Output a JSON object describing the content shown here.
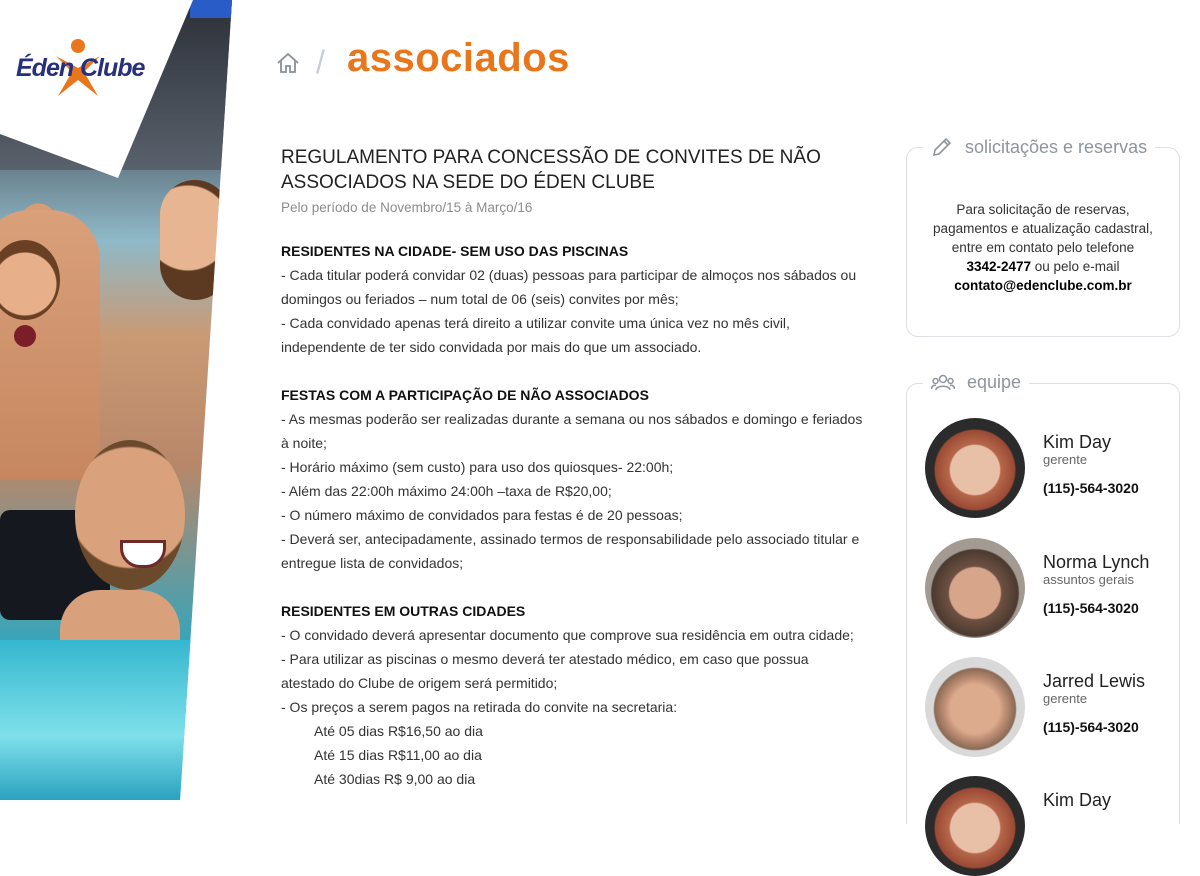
{
  "brand": {
    "name_part1": "Éden",
    "name_part2": "Clube",
    "accent_color": "#e8761b",
    "logo_color": "#27307d"
  },
  "header": {
    "home_icon": "home-icon",
    "separator": "/",
    "title": "associados"
  },
  "document": {
    "title": "REGULAMENTO PARA CONCESSÃO DE CONVITES DE NÃO ASSOCIADOS NA SEDE DO ÉDEN CLUBE",
    "title_line1": "REGULAMENTO PARA CONCESSÃO DE CONVITES DE NÃO",
    "title_line2": "ASSOCIADOS NA SEDE DO ÉDEN CLUBE",
    "period": "Pelo período de Novembro/15 à Março/16",
    "sections": [
      {
        "title": "RESIDENTES NA CIDADE- SEM USO DAS PISCINAS",
        "lines": [
          "- Cada titular poderá convidar 02 (duas) pessoas para participar de almoços nos sábados ou",
          "domingos ou feriados – num total de 06 (seis) convites por mês;",
          "- Cada convidado apenas terá direito a utilizar convite uma única vez no mês civil,",
          "independente de ter sido convidada por mais do que um associado."
        ]
      },
      {
        "title": "FESTAS COM A PARTICIPAÇÃO DE NÃO ASSOCIADOS",
        "lines": [
          "- As mesmas poderão ser realizadas durante a semana ou nos sábados e domingo e feriados",
          "à noite;",
          "- Horário máximo (sem custo) para uso dos quiosques- 22:00h;",
          "- Além das 22:00h máximo 24:00h –taxa de R$20,00;",
          "- O número máximo de convidados para festas é de 20 pessoas;",
          "- Deverá ser, antecipadamente, assinado termos de responsabilidade pelo associado titular e",
          "entregue lista de convidados;"
        ]
      },
      {
        "title": "RESIDENTES EM OUTRAS CIDADES",
        "lines": [
          "- O convidado deverá apresentar documento que comprove sua residência em outra cidade;",
          "- Para utilizar as piscinas o mesmo deverá ter atestado médico, em caso que possua",
          "atestado do Clube de origem será permitido;",
          "- Os preços a serem pagos na retirada do convite na secretaria:"
        ],
        "prices": [
          "Até 05 dias R$16,50 ao dia",
          "Até 15 dias R$11,00 ao dia",
          "Até 30dias R$ 9,00 ao dia"
        ]
      }
    ]
  },
  "sidebar": {
    "requests": {
      "icon": "pencil-icon",
      "title": "solicitações e reservas",
      "line1": "Para solicitação de reservas,",
      "line2": "pagamentos e atualização cadastral,",
      "line3": "entre em contato pelo telefone",
      "phone": "3342-2477",
      "or_email": " ou pelo e-mail",
      "email": "contato@edenclube.com.br"
    },
    "team": {
      "icon": "team-icon",
      "title": "equipe",
      "members": [
        {
          "name": "Kim Day",
          "role": "gerente",
          "phone": "(115)-564-3020"
        },
        {
          "name": "Norma Lynch",
          "role": "assuntos gerais",
          "phone": "(115)-564-3020"
        },
        {
          "name": "Jarred Lewis",
          "role": "gerente",
          "phone": "(115)-564-3020"
        },
        {
          "name": "Kim Day",
          "role": "",
          "phone": ""
        }
      ]
    }
  }
}
